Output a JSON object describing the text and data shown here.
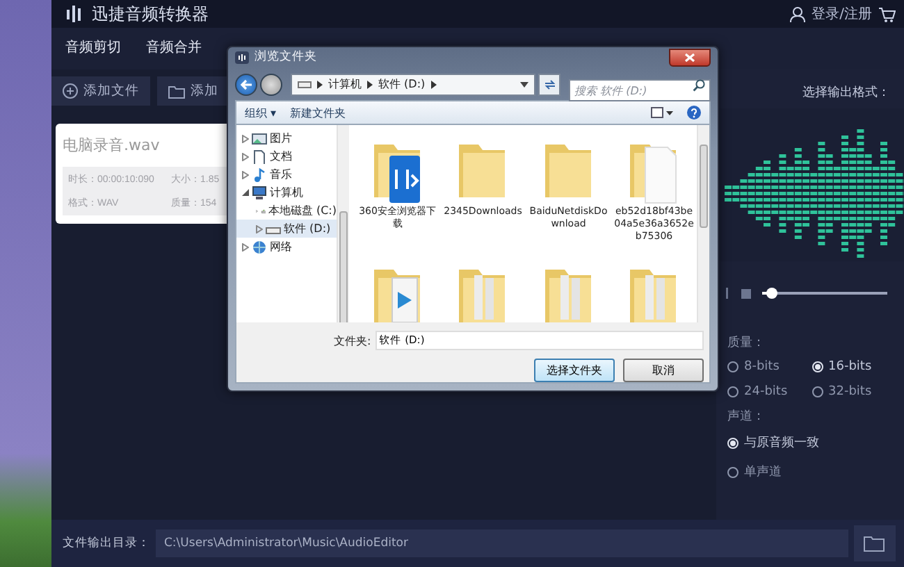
{
  "app": {
    "title": "迅捷音频转换器",
    "account": "登录/注册"
  },
  "tabs": [
    {
      "label": "音频剪切",
      "selected": false
    },
    {
      "label": "音频合并",
      "selected": false
    }
  ],
  "toolbar": {
    "add_file": "添加文件",
    "add_folder": "添加"
  },
  "file_card": {
    "name": "电脑录音.wav",
    "duration": "时长：00:00:10:090",
    "size": "大小：1.85",
    "format": "格式：WAV",
    "quality": "质量：154"
  },
  "output_panel": {
    "format_label": "选择输出格式：",
    "slider": {
      "level": 0.08
    },
    "quality_label": "质量：",
    "quality_options": [
      {
        "label": "8-bits",
        "selected": false
      },
      {
        "label": "16-bits",
        "selected": true
      },
      {
        "label": "24-bits",
        "selected": false
      },
      {
        "label": "32-bits",
        "selected": false
      }
    ],
    "channel_label": "声道：",
    "channel_options": [
      {
        "label": "与原音频一致",
        "selected": true
      },
      {
        "label": "单声道",
        "selected": false
      }
    ]
  },
  "footer": {
    "label": "文件输出目录：",
    "path": "C:\\Users\\Administrator\\Music\\AudioEditor"
  },
  "dialog": {
    "title": "浏览文件夹",
    "breadcrumb": [
      "计算机",
      "软件 (D:)"
    ],
    "search": {
      "placeholder": "搜索 软件 (D:)"
    },
    "commands": [
      "组织 ▾",
      "新建文件夹"
    ],
    "tree": [
      {
        "label": "图片",
        "kind": "picture",
        "selected": false
      },
      {
        "label": "文档",
        "kind": "document",
        "selected": false
      },
      {
        "label": "音乐",
        "kind": "music",
        "selected": false
      },
      {
        "label": "计算机",
        "kind": "computer",
        "selected": false,
        "expanded": true,
        "children": [
          {
            "label": "本地磁盘 (C:)",
            "kind": "disk",
            "selected": false
          },
          {
            "label": "软件 (D:)",
            "kind": "drive",
            "selected": true
          }
        ]
      },
      {
        "label": "网络",
        "kind": "network",
        "selected": false
      }
    ],
    "items": [
      {
        "label": "360安全浏览器下载",
        "kind": "app"
      },
      {
        "label": "2345Downloads",
        "kind": "plain"
      },
      {
        "label": "BaiduNetdiskDownload",
        "kind": "plain"
      },
      {
        "label": "eb52d18bf43be04a5e36a3652eb75306",
        "kind": "paper"
      },
      {
        "kind": "media"
      },
      {
        "kind": "files"
      },
      {
        "kind": "files"
      },
      {
        "kind": "files"
      }
    ],
    "folder_label": "文件夹:",
    "folder_value": "软件 (D:)",
    "buttons": [
      "选择文件夹",
      "取消"
    ]
  }
}
